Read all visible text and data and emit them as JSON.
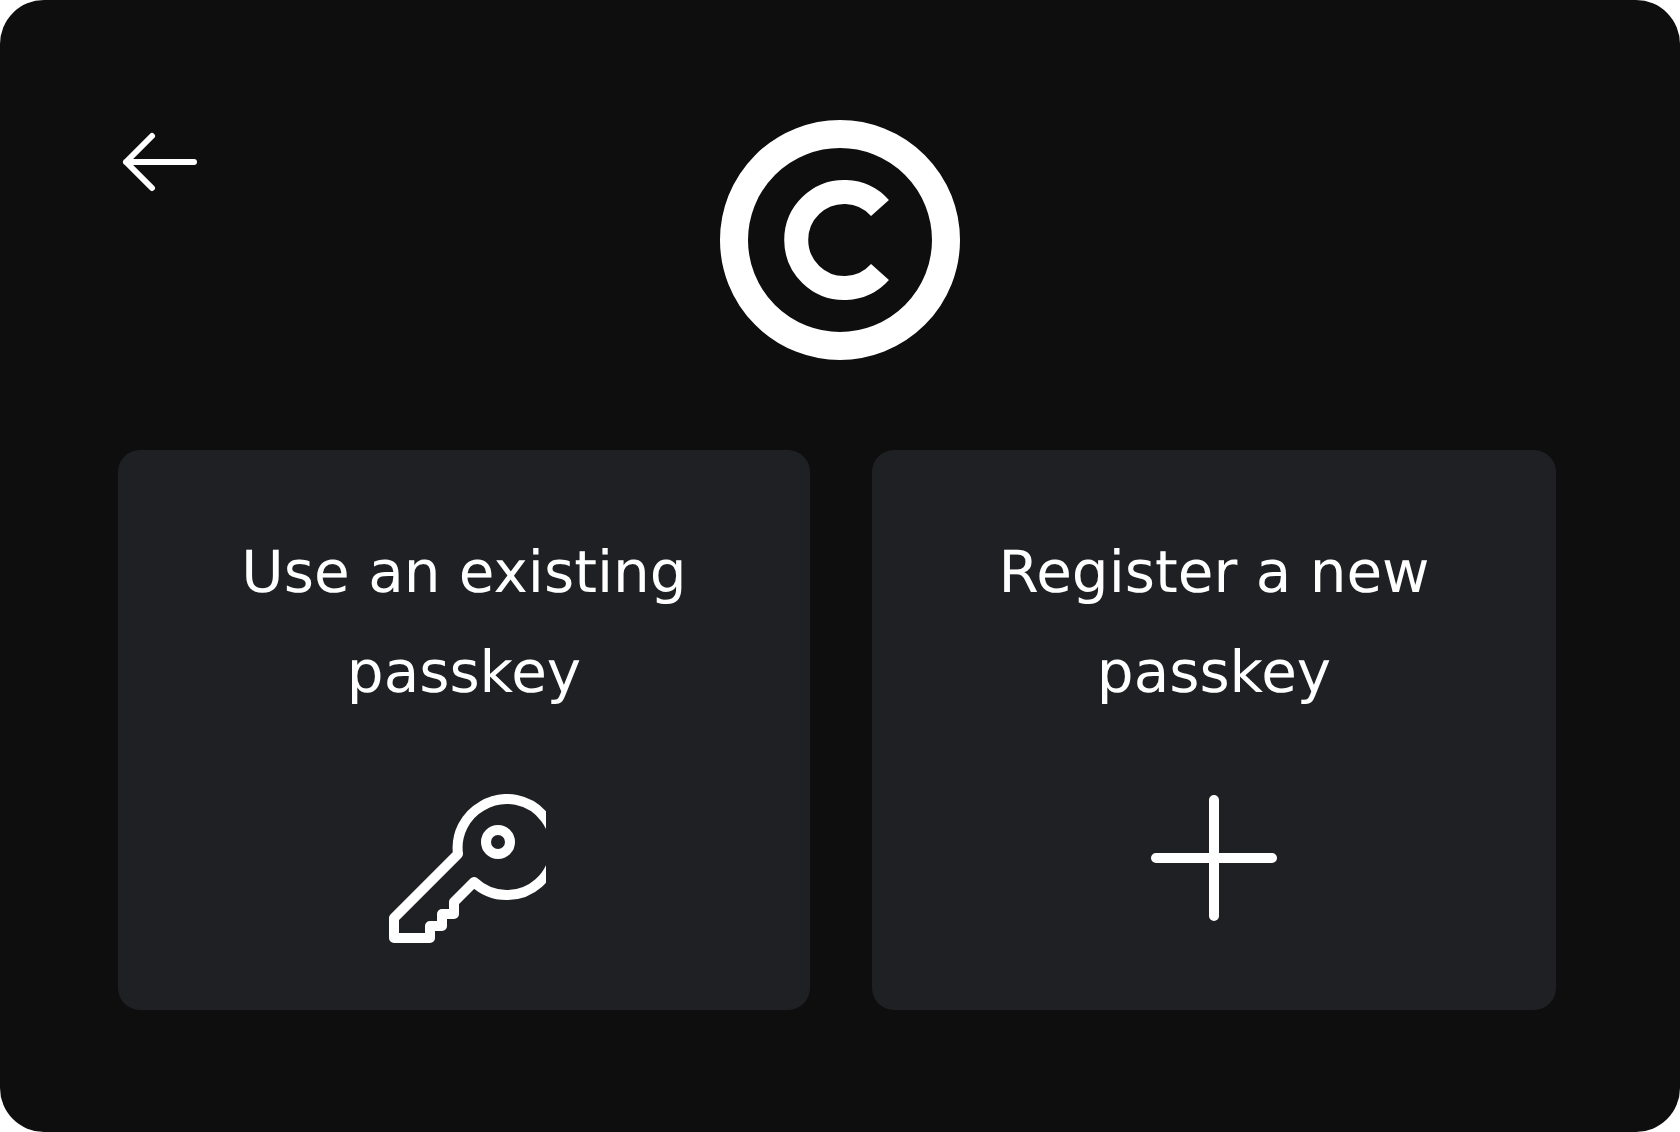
{
  "cards": [
    {
      "kind": "existing",
      "label": "Use an existing passkey"
    },
    {
      "kind": "new",
      "label": "Register a new passkey"
    }
  ]
}
